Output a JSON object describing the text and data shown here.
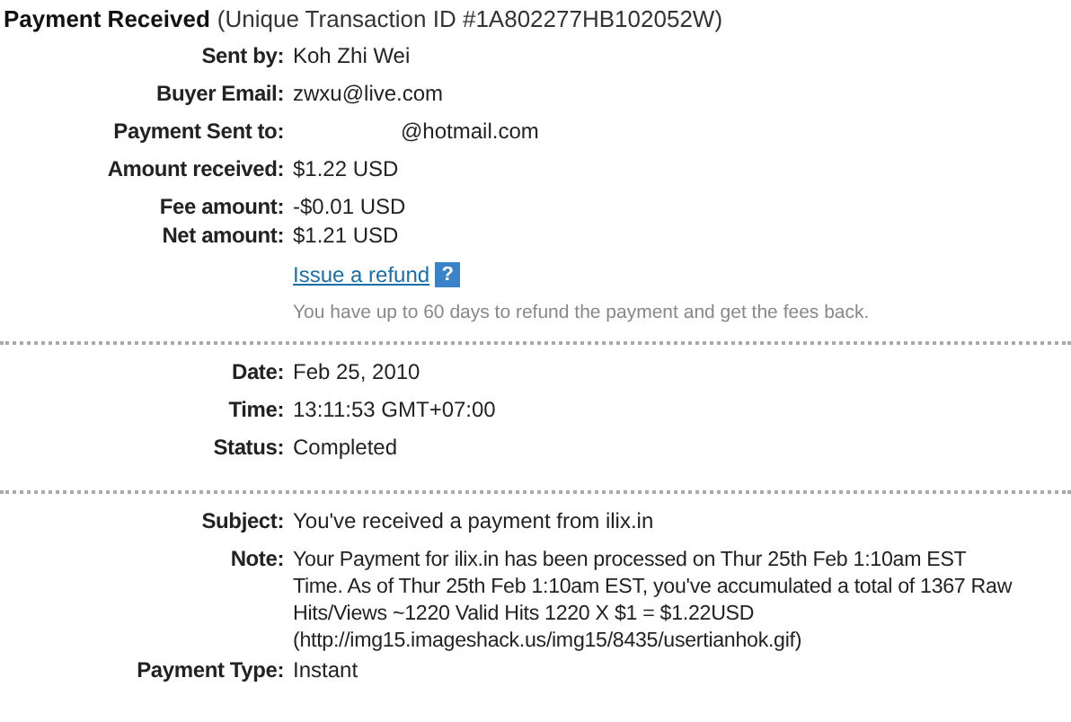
{
  "title": {
    "main": "Payment Received",
    "detail": "(Unique Transaction ID #1A802277HB102052W)"
  },
  "sections": [
    {
      "rows": [
        {
          "kind": "field",
          "label": "Sent by:",
          "value": "Koh Zhi Wei"
        },
        {
          "kind": "field",
          "label": "Buyer Email:",
          "value": "zwxu@live.com"
        },
        {
          "kind": "field",
          "label": "Payment Sent to:",
          "value": "@hotmail.com",
          "redacted": true
        },
        {
          "kind": "field",
          "label": "Amount received:",
          "value": "$1.22 USD"
        },
        {
          "kind": "compact",
          "label": "Fee amount:",
          "value": "-$0.01 USD"
        },
        {
          "kind": "compact",
          "label": "Net amount:",
          "value": "$1.21 USD"
        }
      ],
      "refund": {
        "link": "Issue a refund",
        "help": "?",
        "hint": "You have up to 60 days to refund the payment and get the fees back."
      }
    },
    {
      "rows": [
        {
          "kind": "field",
          "label": "Date:",
          "value": "Feb 25, 2010"
        },
        {
          "kind": "field",
          "label": "Time:",
          "value": "13:11:53 GMT+07:00"
        },
        {
          "kind": "field",
          "label": "Status:",
          "value": "Completed"
        }
      ]
    },
    {
      "rows": [
        {
          "kind": "field",
          "label": "Subject:",
          "value": "You've received a payment from ilix.in"
        },
        {
          "kind": "note",
          "label": "Note:",
          "lines": [
            "Your Payment for ilix.in has been processed on Thur 25th Feb 1:10am EST",
            "Time. As of Thur 25th Feb 1:10am EST, you've accumulated a total of 1367 Raw",
            "Hits/Views ~1220 Valid Hits 1220 X $1 = $1.22USD",
            "(http://img15.imageshack.us/img15/8435/usertianhok.gif)"
          ]
        },
        {
          "kind": "compact",
          "label": "Payment Type:",
          "value": "Instant"
        }
      ]
    }
  ]
}
